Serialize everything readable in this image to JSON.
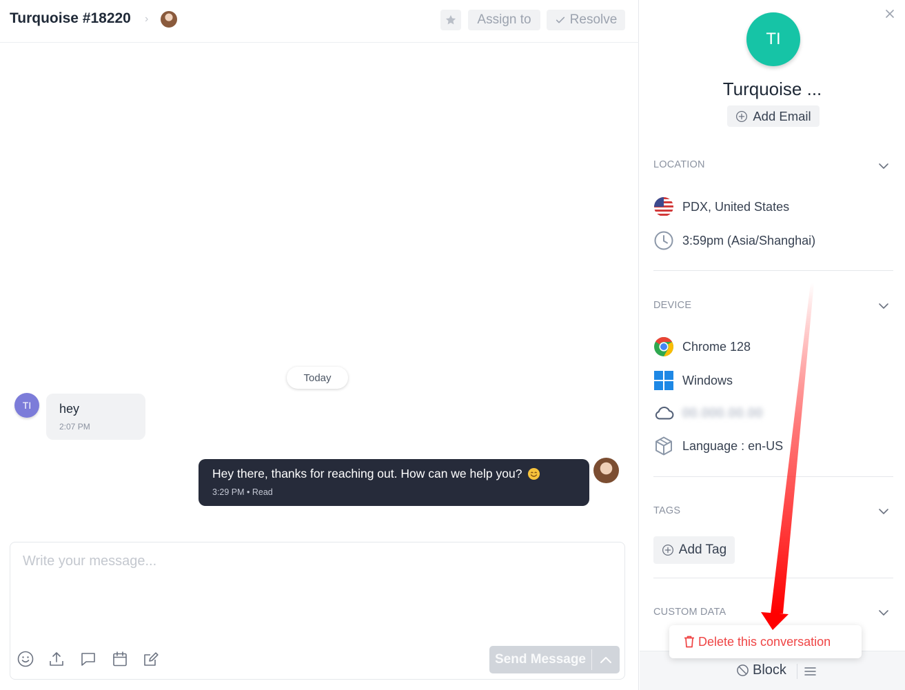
{
  "header": {
    "title": "Turquoise #18220",
    "breadcrumb_separator": "›",
    "assign_label": "Assign to",
    "resolve_label": "Resolve"
  },
  "conversation": {
    "day_label": "Today",
    "messages": [
      {
        "author_initials": "TI",
        "text": "hey",
        "meta": "2:07 PM"
      },
      {
        "text": "Hey there, thanks for reaching out. How can we help you?",
        "meta": "3:29 PM • Read"
      }
    ]
  },
  "composer": {
    "placeholder": "Write your message...",
    "send_label": "Send Message"
  },
  "contact": {
    "initials": "TI",
    "name": "Turquoise ...",
    "add_email_label": "Add Email"
  },
  "location": {
    "heading": "LOCATION",
    "place": "PDX, United States",
    "local_time": "3:59pm (Asia/Shanghai)"
  },
  "device": {
    "heading": "DEVICE",
    "browser": "Chrome 128",
    "os": "Windows",
    "ip_masked": "00.000.00.00",
    "language": "Language : en-US"
  },
  "tags": {
    "heading": "TAGS",
    "add_label": "Add Tag"
  },
  "custom_data": {
    "heading": "CUSTOM DATA"
  },
  "actions": {
    "block_label": "Block",
    "delete_label": "Delete this conversation"
  },
  "colors": {
    "accent_teal": "#16c4a6",
    "user_avatar": "#7c7cd9",
    "agent_bubble": "#262b3a",
    "danger": "#ef4444",
    "annotation_arrow": "#ff0000"
  }
}
